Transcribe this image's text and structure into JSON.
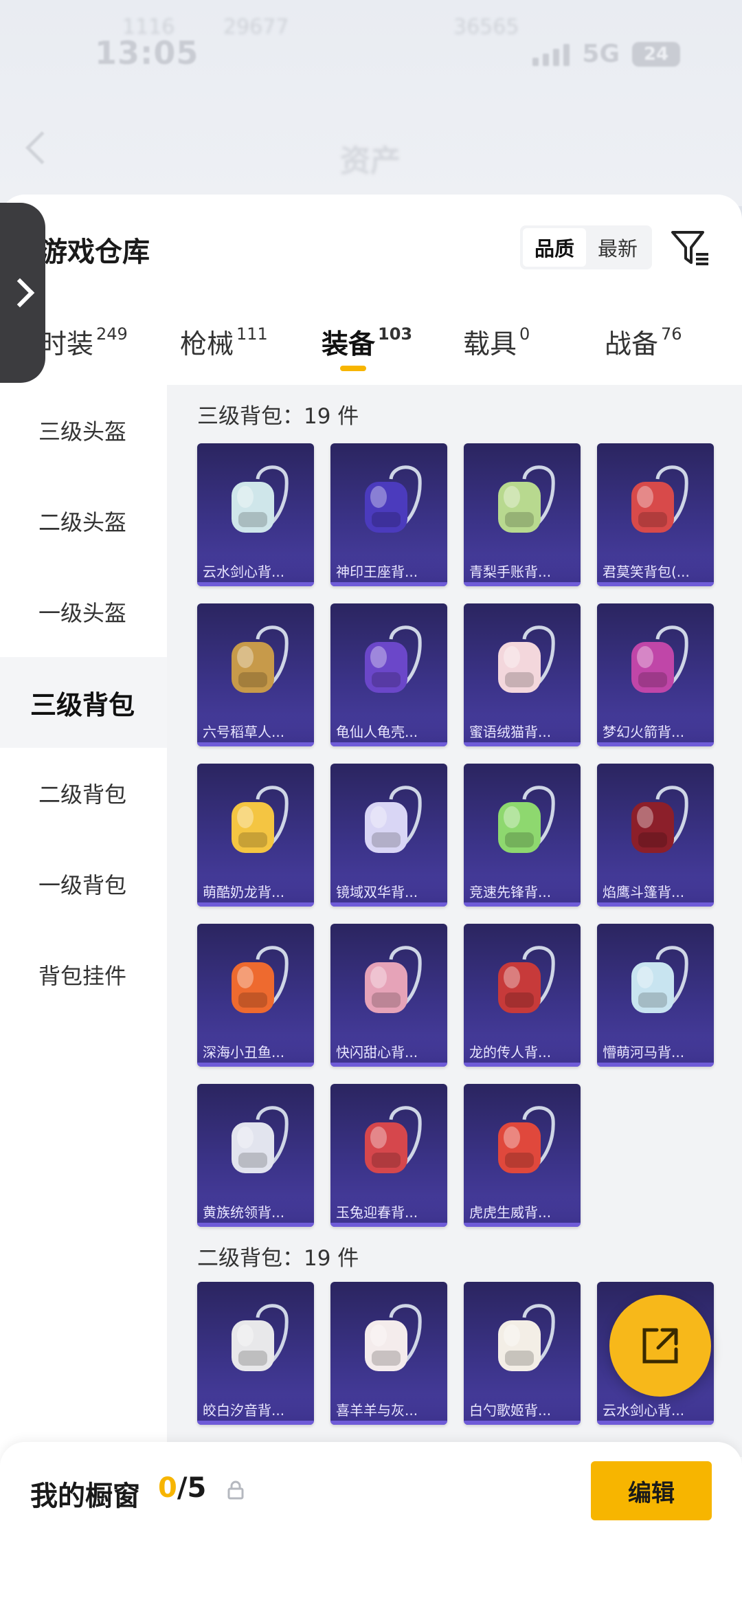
{
  "status_bar": {
    "time": "13:05",
    "network": "5G",
    "battery": "24",
    "blurred_left": "1116",
    "blurred_mid": "29677",
    "blurred_right": "36565"
  },
  "page": {
    "title": "资产"
  },
  "panel": {
    "title": "游戏仓库",
    "sort_options": [
      "品质",
      "最新"
    ],
    "sort_selected": "品质"
  },
  "tabs": [
    {
      "label": "时装",
      "count": "249",
      "active": false
    },
    {
      "label": "枪械",
      "count": "111",
      "active": false
    },
    {
      "label": "装备",
      "count": "103",
      "active": true
    },
    {
      "label": "载具",
      "count": "0",
      "active": false
    },
    {
      "label": "战备",
      "count": "76",
      "active": false
    }
  ],
  "sidebar": {
    "items": [
      "三级头盔",
      "二级头盔",
      "一级头盔",
      "三级背包",
      "二级背包",
      "一级背包",
      "背包挂件"
    ],
    "active": "三级背包"
  },
  "sections": [
    {
      "title": "三级背包：19 件",
      "items": [
        {
          "name": "云水剑心背...",
          "icon": "sword-backpack-icon",
          "color": "#cfe6ea"
        },
        {
          "name": "神印王座背...",
          "icon": "throne-backpack-icon",
          "color": "#4b3bbd"
        },
        {
          "name": "青梨手账背...",
          "icon": "pear-backpack-icon",
          "color": "#b8d98f"
        },
        {
          "name": "君莫笑背包(...",
          "icon": "wing-backpack-icon",
          "color": "#d84a4a"
        },
        {
          "name": "六号稻草人...",
          "icon": "scarecrow-backpack-icon",
          "color": "#c79a4a"
        },
        {
          "name": "龟仙人龟壳...",
          "icon": "turtle-shell-icon",
          "color": "#6b47c9"
        },
        {
          "name": "蜜语绒猫背...",
          "icon": "cat-backpack-icon",
          "color": "#f3d7dc"
        },
        {
          "name": "梦幻火箭背...",
          "icon": "rocket-backpack-icon",
          "color": "#c046a8"
        },
        {
          "name": "萌酷奶龙背...",
          "icon": "dragon-backpack-icon",
          "color": "#f4c542"
        },
        {
          "name": "镜域双华背...",
          "icon": "mirror-backpack-icon",
          "color": "#d9d6f5"
        },
        {
          "name": "竞速先锋背...",
          "icon": "racer-backpack-icon",
          "color": "#8ed86f"
        },
        {
          "name": "焰鹰斗篷背...",
          "icon": "eagle-backpack-icon",
          "color": "#8c1f2a"
        },
        {
          "name": "深海小丑鱼...",
          "icon": "clownfish-backpack-icon",
          "color": "#ee6a2f"
        },
        {
          "name": "快闪甜心背...",
          "icon": "heart-backpack-icon",
          "color": "#e6a3b8"
        },
        {
          "name": "龙的传人背...",
          "icon": "dragon-heir-backpack-icon",
          "color": "#c73a3a"
        },
        {
          "name": "懵萌河马背...",
          "icon": "hippo-backpack-icon",
          "color": "#c8e4f0"
        },
        {
          "name": "黄族统领背...",
          "icon": "commander-backpack-icon",
          "color": "#e2e4ee"
        },
        {
          "name": "玉兔迎春背...",
          "icon": "rabbit-spring-backpack-icon",
          "color": "#d6474c"
        },
        {
          "name": "虎虎生威背...",
          "icon": "tiger-backpack-icon",
          "color": "#e0483c"
        }
      ]
    },
    {
      "title": "二级背包：19 件",
      "items": [
        {
          "name": "皎白汐音背...",
          "icon": "shell-backpack-icon",
          "color": "#e8e8ea"
        },
        {
          "name": "喜羊羊与灰...",
          "icon": "sheep-backpack-icon",
          "color": "#f4ecec"
        },
        {
          "name": "白勺歌姬背...",
          "icon": "bunny-backpack-icon",
          "color": "#f3eee6"
        },
        {
          "name": "云水剑心背...",
          "icon": "sword-backpack-icon",
          "color": "#cfe6ea"
        }
      ]
    }
  ],
  "share_button": {
    "icon": "share-icon"
  },
  "showcase": {
    "label": "我的橱窗",
    "used": "0",
    "total": "/5",
    "edit_label": "编辑"
  }
}
